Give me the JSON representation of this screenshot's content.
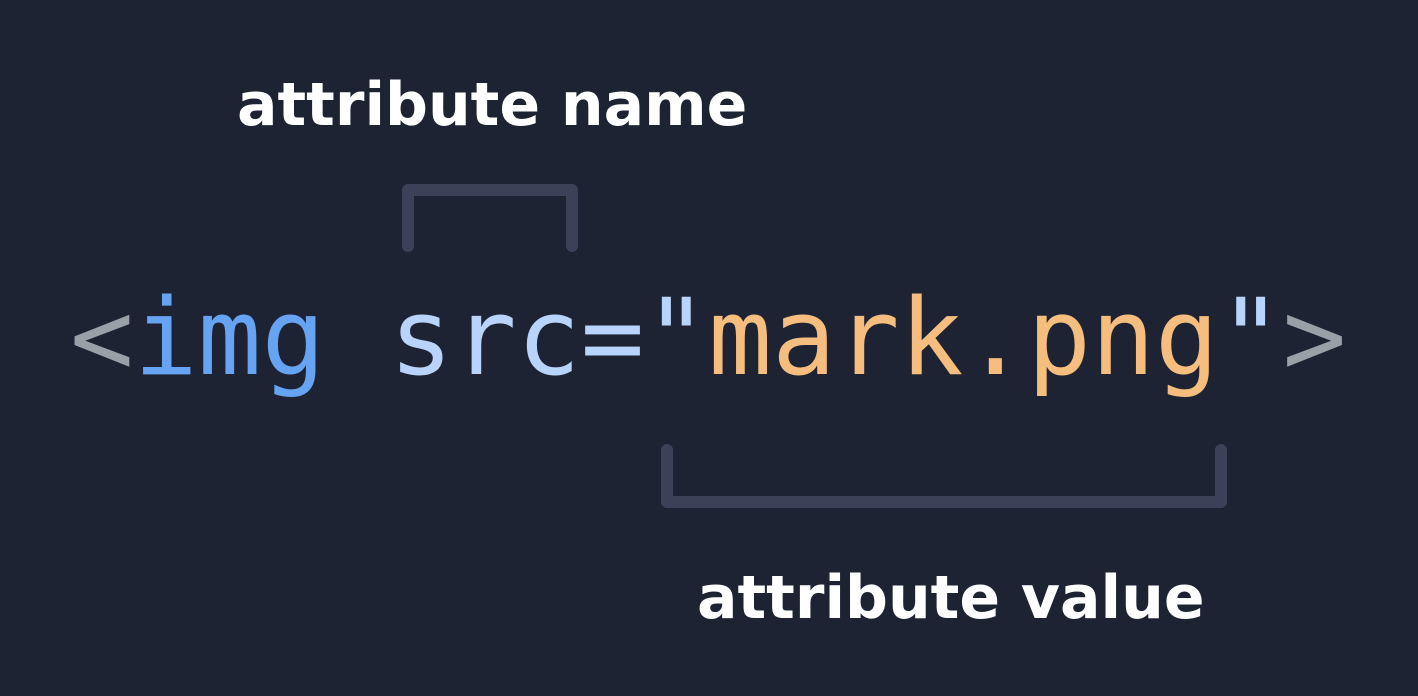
{
  "labels": {
    "attribute_name": "attribute name",
    "attribute_value": "attribute value"
  },
  "code": {
    "open_bracket": "<",
    "tag_name": "img",
    "space": " ",
    "attr_name": "src",
    "equals_quote_open": "=\"",
    "attr_value": "mark.png",
    "quote_close": "\"",
    "close_bracket": ">"
  },
  "colors": {
    "background": "#1e2333",
    "bracket": "#9aa0a8",
    "tag": "#66a3f2",
    "attribute": "#b9d4fb",
    "value": "#f6be7e",
    "connector": "#3b4257",
    "label_text": "#ffffff"
  }
}
